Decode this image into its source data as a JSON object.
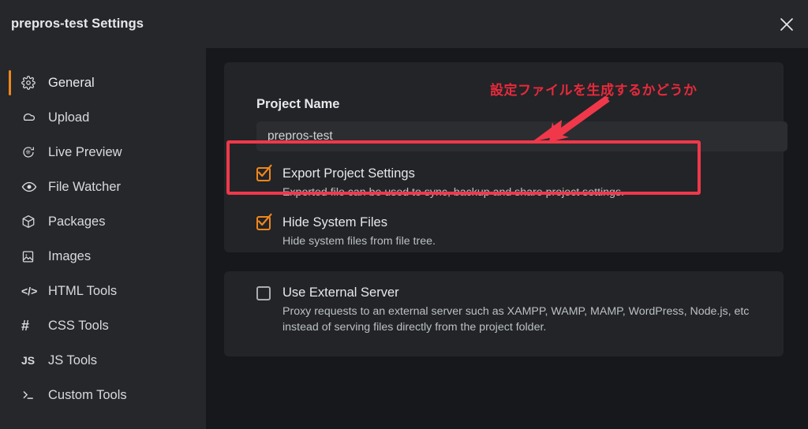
{
  "window": {
    "title": "prepros-test Settings",
    "close_label": "close-icon"
  },
  "sidebar": {
    "items": [
      {
        "label": "General",
        "icon": "gear-icon",
        "active": true
      },
      {
        "label": "Upload",
        "icon": "cloud-icon",
        "active": false
      },
      {
        "label": "Live Preview",
        "icon": "live-preview-icon",
        "active": false
      },
      {
        "label": "File Watcher",
        "icon": "eye-icon",
        "active": false
      },
      {
        "label": "Packages",
        "icon": "package-icon",
        "active": false
      },
      {
        "label": "Images",
        "icon": "image-icon",
        "active": false
      },
      {
        "label": "HTML Tools",
        "icon": "code-icon",
        "active": false
      },
      {
        "label": "CSS Tools",
        "icon": "hash-icon",
        "active": false
      },
      {
        "label": "JS Tools",
        "icon": "js-icon",
        "active": false
      },
      {
        "label": "Custom Tools",
        "icon": "terminal-icon",
        "active": false
      }
    ]
  },
  "main": {
    "project_name": {
      "label": "Project Name",
      "value": "prepros-test",
      "placeholder": "Project Name"
    },
    "options": [
      {
        "key": "export_project_settings",
        "title": "Export Project Settings",
        "description": "Exported file can be used to sync, backup and share project settings.",
        "checked": true
      },
      {
        "key": "hide_system_files",
        "title": "Hide System Files",
        "description": "Hide system files from file tree.",
        "checked": true
      },
      {
        "key": "use_external_server",
        "title": "Use External Server",
        "description": "Proxy requests to an external server such as XAMPP, WAMP, MAMP, WordPress, Node.js, etc instead of serving files directly from the project folder.",
        "checked": false
      }
    ]
  },
  "annotations": {
    "callout_text": "設定ファイルを生成するかどうか",
    "highlight_color": "#f0384a",
    "accent_color": "#f0861c"
  }
}
